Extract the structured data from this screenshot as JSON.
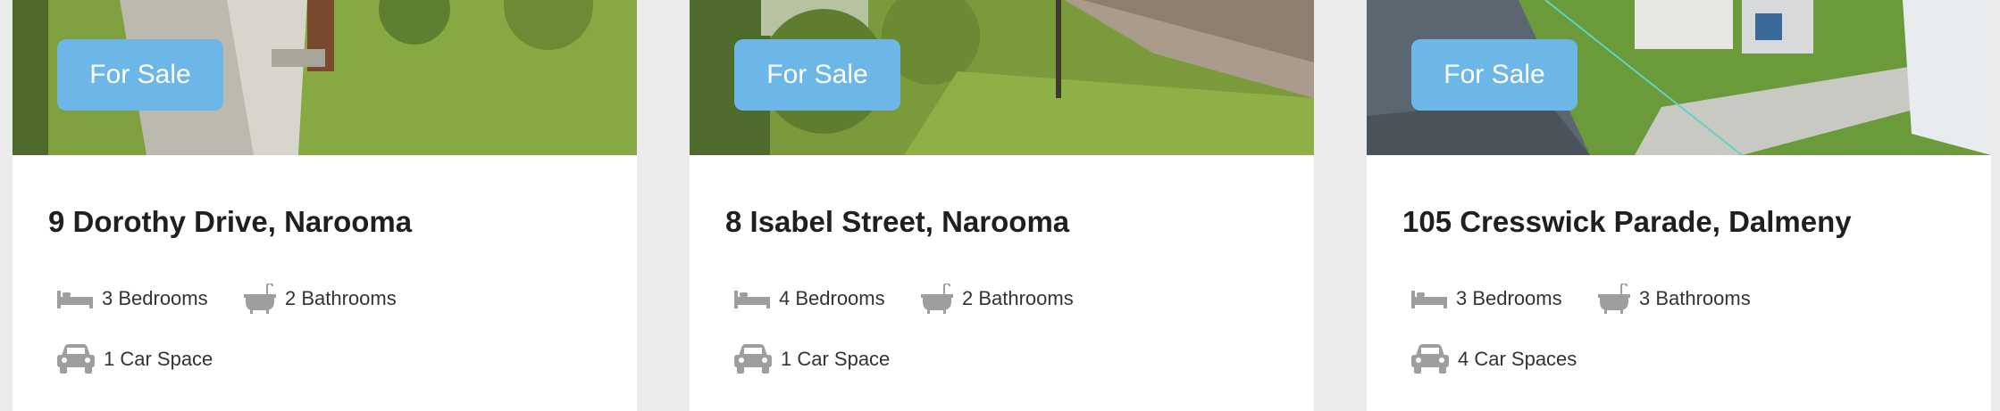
{
  "listings": [
    {
      "badge": "For Sale",
      "address": "9 Dorothy Drive, Narooma",
      "bedrooms": "3 Bedrooms",
      "bathrooms": "2 Bathrooms",
      "cars": "1 Car Space"
    },
    {
      "badge": "For Sale",
      "address": "8 Isabel Street, Narooma",
      "bedrooms": "4 Bedrooms",
      "bathrooms": "2 Bathrooms",
      "cars": "1 Car Space"
    },
    {
      "badge": "For Sale",
      "address": "105 Cresswick Parade, Dalmeny",
      "bedrooms": "3 Bedrooms",
      "bathrooms": "3 Bathrooms",
      "cars": "4 Car Spaces"
    }
  ],
  "colors": {
    "badge_bg": "#6db6e8",
    "page_bg": "#ebebeb",
    "icon_gray": "#9e9e9e"
  },
  "icons": [
    "bed-icon",
    "bathtub-icon",
    "car-icon"
  ]
}
